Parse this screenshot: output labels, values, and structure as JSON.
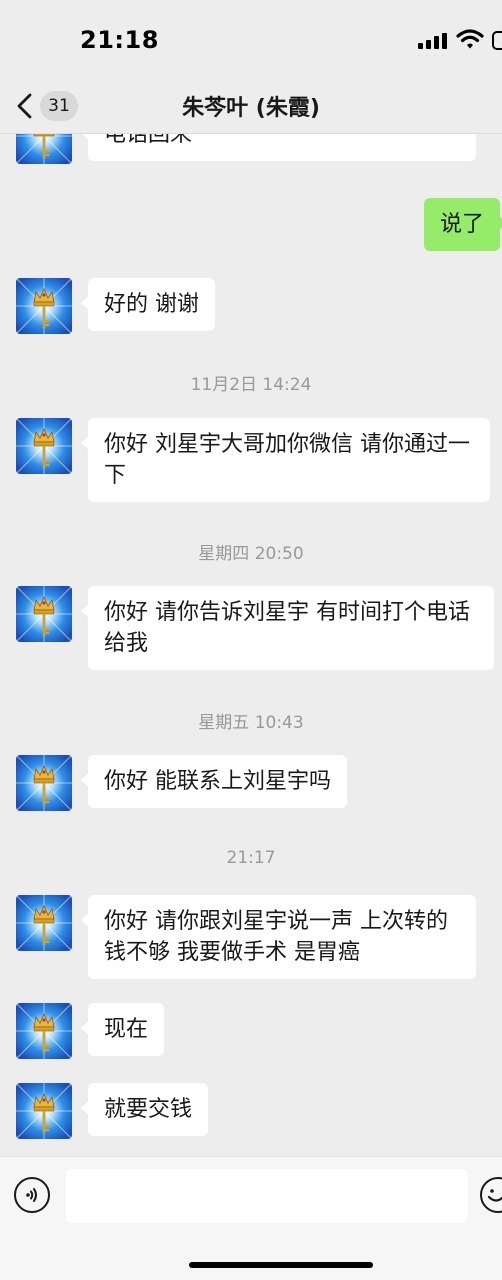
{
  "status_bar": {
    "time": "21:18"
  },
  "nav": {
    "unread_count": "31",
    "title": "朱芩叶 (朱霞)"
  },
  "messages": [
    {
      "type": "received",
      "text": "电话回来"
    },
    {
      "type": "sent",
      "text": "说了"
    },
    {
      "type": "received",
      "text": "好的  谢谢"
    },
    {
      "type": "time",
      "text": "11月2日 14:24"
    },
    {
      "type": "received",
      "text": "你好 刘星宇大哥加你微信 请你通过一下"
    },
    {
      "type": "time",
      "text": "星期四 20:50"
    },
    {
      "type": "received",
      "text": "你好  请你告诉刘星宇 有时间打个电话给我"
    },
    {
      "type": "time",
      "text": "星期五 10:43"
    },
    {
      "type": "received",
      "text": "你好  能联系上刘星宇吗"
    },
    {
      "type": "time",
      "text": "21:17"
    },
    {
      "type": "received",
      "text": "你好  请你跟刘星宇说一声  上次转的钱不够  我要做手术  是胃癌"
    },
    {
      "type": "received",
      "text": "现在"
    },
    {
      "type": "received",
      "text": "就要交钱"
    }
  ],
  "input": {
    "value": ""
  },
  "colors": {
    "background": "#ededed",
    "sent_bubble": "#95ec69",
    "received_bubble": "#ffffff",
    "timestamp_text": "#999999"
  },
  "icons": {
    "back": "chevron-left-icon",
    "voice": "voice-icon",
    "emoji": "emoji-icon",
    "avatar": "crown-key-avatar"
  }
}
